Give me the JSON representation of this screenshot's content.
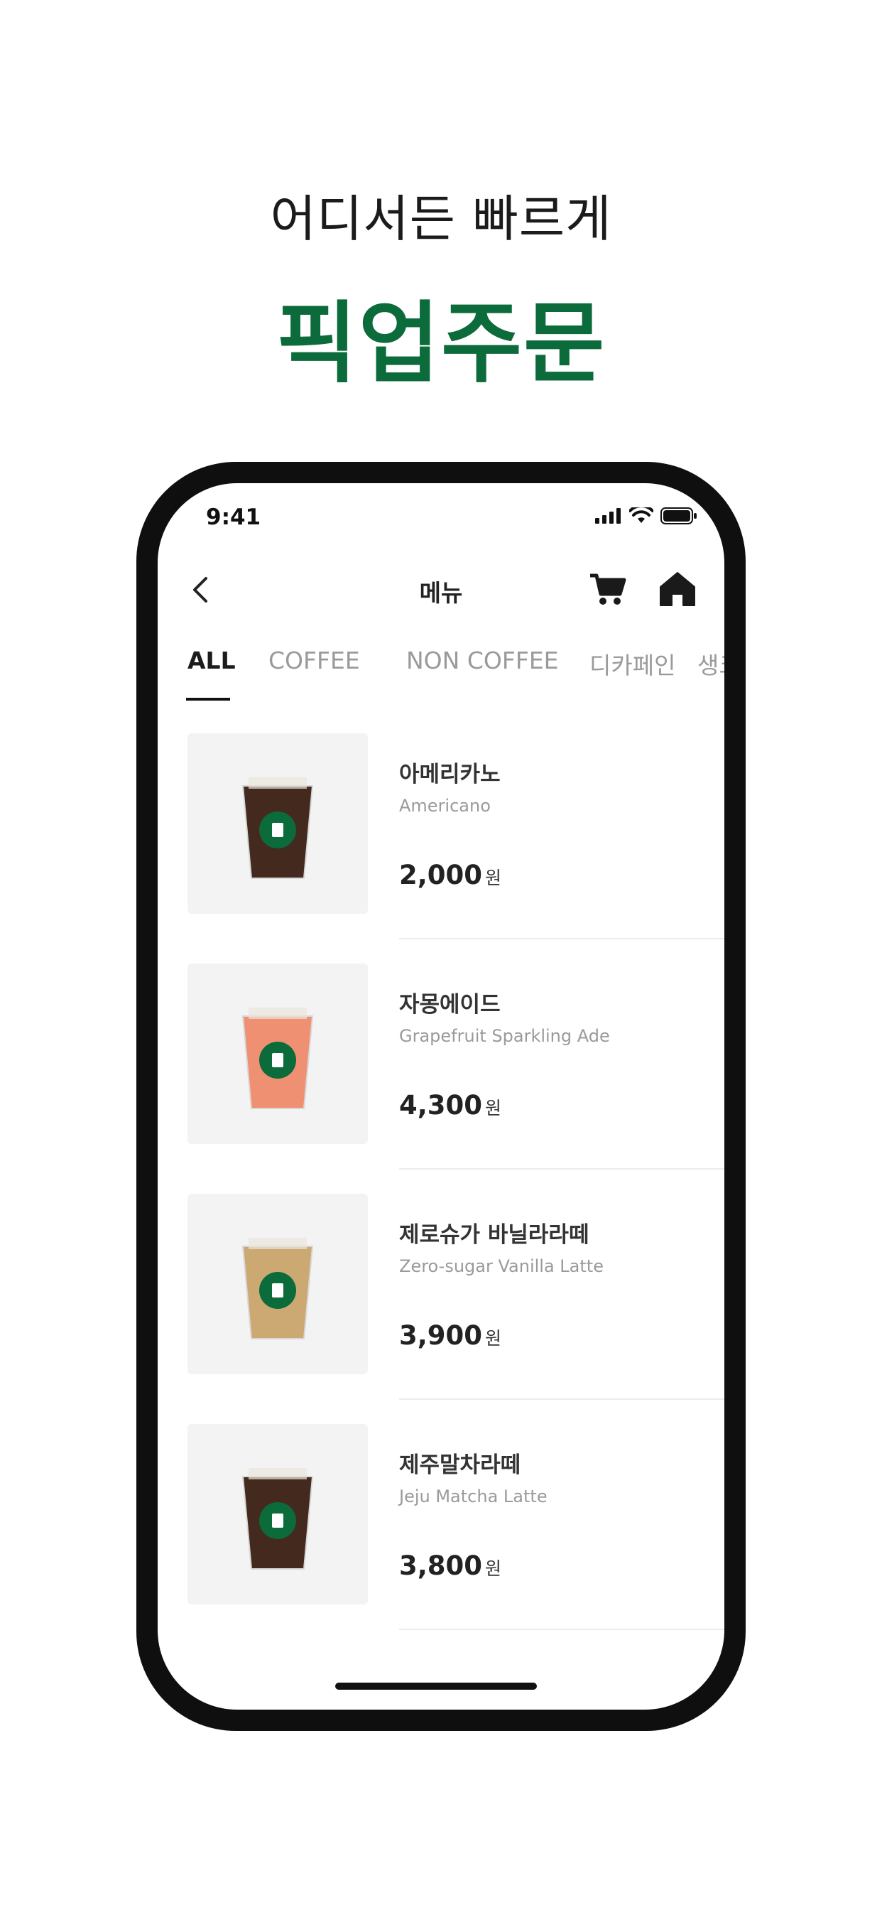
{
  "promo": {
    "headline": "어디서든 빠르게",
    "headline_main": "픽업주문"
  },
  "colors": {
    "brand_green": "#0b6b3a",
    "tab_active": "#1c1c1c",
    "tab_inactive": "#9a9a9a"
  },
  "status_bar": {
    "time": "9:41",
    "icons": [
      "signal-icon",
      "wifi-icon",
      "battery-icon"
    ]
  },
  "header": {
    "title": "메뉴",
    "icons": [
      "back-arrow-icon",
      "cart-icon",
      "home-icon"
    ]
  },
  "tabs": [
    {
      "label": "ALL",
      "active": true
    },
    {
      "label": "COFFEE",
      "active": false
    },
    {
      "label": "NON COFFEE",
      "active": false
    },
    {
      "label": "디카페인",
      "active": false
    },
    {
      "label": "생크",
      "active": false
    }
  ],
  "menu_items": [
    {
      "name": "아메리카노",
      "name_en": "Americano",
      "price": "2,000",
      "currency": "원",
      "drink_color": "#3a1f12"
    },
    {
      "name": "자몽에이드",
      "name_en": "Grapefruit Sparkling Ade",
      "price": "4,300",
      "currency": "원",
      "drink_color": "#ef8a6a"
    },
    {
      "name": "제로슈가 바닐라라떼",
      "name_en": "Zero-sugar Vanilla Latte",
      "price": "3,900",
      "currency": "원",
      "drink_color": "#c9a46c"
    },
    {
      "name": "제주말차라떼",
      "name_en": "Jeju Matcha Latte",
      "price": "3,800",
      "currency": "원",
      "drink_color": "#3a1f12"
    }
  ]
}
